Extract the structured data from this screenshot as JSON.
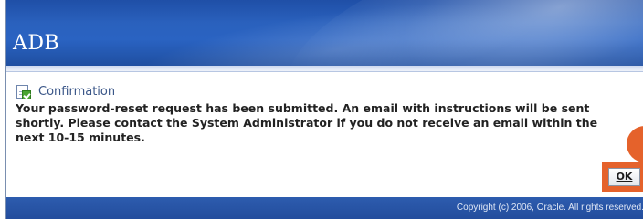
{
  "header": {
    "logo_text": "ADB"
  },
  "confirmation": {
    "icon": "confirmation-icon",
    "title": "Confirmation",
    "message": "Your password-reset request has been submitted. An email with instructions will be sent shortly. Please contact the System Administrator if you do not receive an email within the next 10-15 minutes."
  },
  "actions": {
    "ok_label": "OK"
  },
  "footer": {
    "copyright": "Copyright (c) 2006, Oracle. All rights reserved."
  },
  "colors": {
    "header_blue": "#2a61bd",
    "highlight_orange": "#e5622b",
    "title_blue": "#3a5688"
  }
}
